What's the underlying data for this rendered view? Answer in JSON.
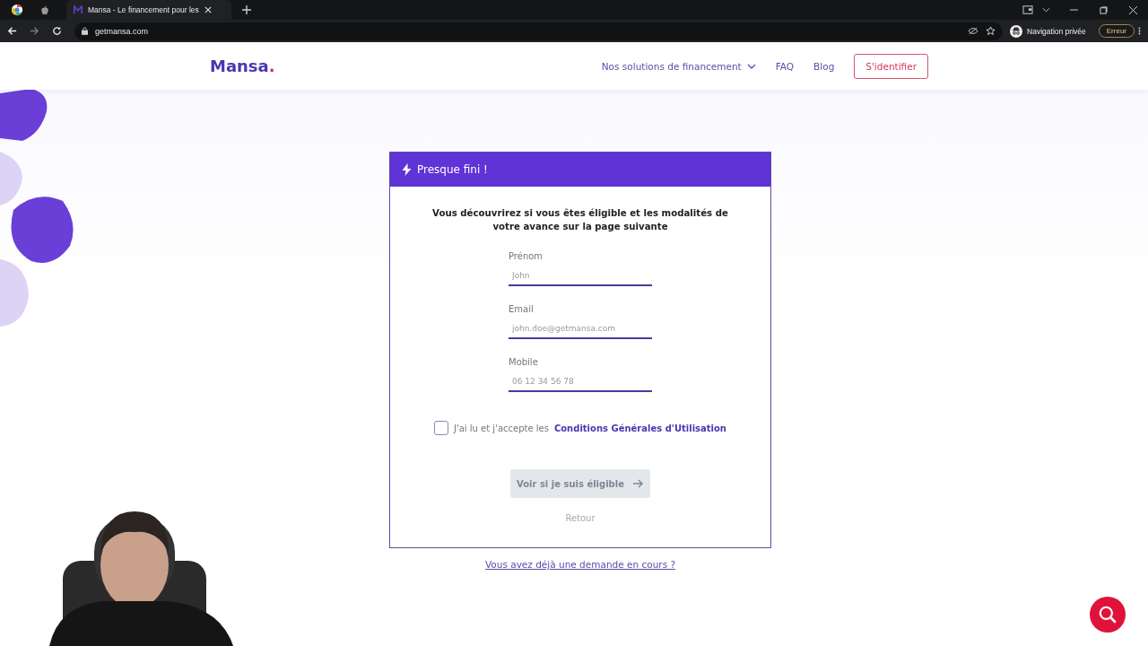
{
  "browser": {
    "tab_title": "Mansa - Le financement pour les",
    "address": "getmansa.com",
    "profile": "Navigation privée",
    "error_button": "Erreur"
  },
  "header": {
    "logo": "Mansa",
    "logo_dot": ".",
    "nav": [
      {
        "label": "Nos solutions de financement",
        "kind": "dropdown"
      },
      {
        "label": "FAQ",
        "kind": "link"
      },
      {
        "label": "Blog",
        "kind": "link"
      }
    ],
    "login_button": "S'identifier"
  },
  "card": {
    "title": "Presque fini !",
    "intro": "Vous découvrirez si vous êtes éligible et les modalités de votre avance sur la page suivante",
    "fields": [
      {
        "label": "Prénom",
        "placeholder": "John"
      },
      {
        "label": "Email",
        "placeholder": "john.doe@getmansa.com"
      },
      {
        "label": "Mobile",
        "placeholder": "06 12 34 56 78"
      }
    ],
    "terms": {
      "checked": false,
      "text": "J'ai lu et j'accepte les",
      "link": "Conditions Générales d'Utilisation"
    },
    "submit": {
      "label": "Voir si je suis éligible",
      "disabled": true
    },
    "back": "Retour"
  },
  "existing_request_link": "Vous avez déjà une demande en cours ?"
}
